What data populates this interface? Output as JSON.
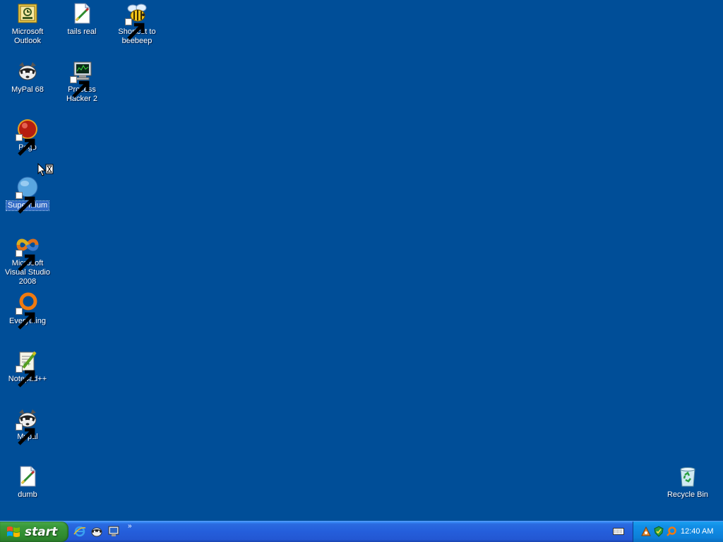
{
  "desktop": {
    "background_color": "#004e98",
    "icons": [
      {
        "label": "Microsoft Outlook",
        "icon": "outlook-icon",
        "shortcut": false
      },
      {
        "label": "tails real",
        "icon": "text-document-icon",
        "shortcut": false
      },
      {
        "label": "Shortcut to beebeep",
        "icon": "bee-icon",
        "shortcut": true
      },
      {
        "label": "MyPal 68",
        "icon": "raccoon-icon",
        "shortcut": false
      },
      {
        "label": "Process Hacker 2",
        "icon": "monitor-icon",
        "shortcut": true
      },
      {
        "label": "Pego",
        "icon": "red-ball-icon",
        "shortcut": true
      },
      {
        "label": "Supermium",
        "icon": "blue-globe-icon",
        "shortcut": true,
        "selected": true
      },
      {
        "label": "Microsoft Visual Studio 2008",
        "icon": "visual-studio-icon",
        "shortcut": true
      },
      {
        "label": "Everything",
        "icon": "orange-ring-icon",
        "shortcut": true
      },
      {
        "label": "Notepad++",
        "icon": "notepadpp-icon",
        "shortcut": true
      },
      {
        "label": "Mypal",
        "icon": "raccoon-icon",
        "shortcut": true
      },
      {
        "label": "dumb",
        "icon": "text-document-icon",
        "shortcut": false
      },
      {
        "label": "Recycle Bin",
        "icon": "recycle-bin-icon",
        "shortcut": false
      }
    ]
  },
  "taskbar": {
    "start_label": "start",
    "quick_launch": [
      "internet-explorer-icon",
      "raccoon-icon",
      "show-desktop-icon"
    ],
    "quick_launch_more": "»",
    "tray_icons": [
      "network-icon",
      "shield-icon",
      "search-icon"
    ],
    "clock": "12:40 AM"
  }
}
